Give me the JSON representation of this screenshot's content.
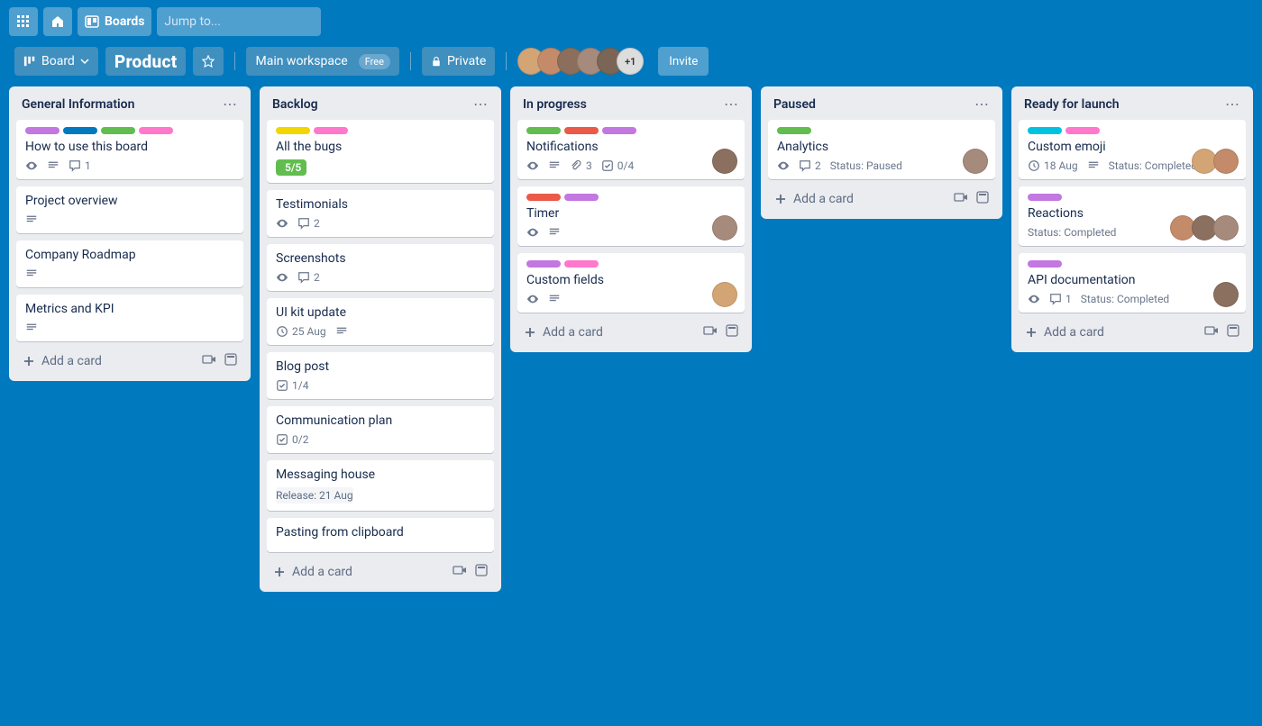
{
  "topbar": {
    "boards": "Boards",
    "search_placeholder": "Jump to..."
  },
  "subbar": {
    "board_btn": "Board",
    "board_name": "Product",
    "workspace": "Main workspace",
    "free": "Free",
    "private": "Private",
    "plus": "+1",
    "invite": "Invite"
  },
  "lists": [
    {
      "title": "General Information",
      "cards": [
        {
          "title": "How to use this board",
          "labels": [
            "purple",
            "blue",
            "green",
            "pink"
          ],
          "badges": {
            "eye": true,
            "desc": true,
            "comments": "1"
          }
        },
        {
          "title": "Project overview",
          "badges": {
            "desc": true
          }
        },
        {
          "title": "Company Roadmap",
          "badges": {
            "desc": true
          }
        },
        {
          "title": "Metrics and KPI",
          "badges": {
            "desc": true
          }
        }
      ]
    },
    {
      "title": "Backlog",
      "cards": [
        {
          "title": "All the bugs",
          "labels": [
            "yellow",
            "pink"
          ],
          "badges": {
            "check_done": "5/5"
          }
        },
        {
          "title": "Testimonials",
          "badges": {
            "eye": true,
            "comments": "2"
          }
        },
        {
          "title": "Screenshots",
          "badges": {
            "eye": true,
            "comments": "2"
          }
        },
        {
          "title": "UI kit update",
          "badges": {
            "date": "25 Aug",
            "desc": true
          }
        },
        {
          "title": "Blog post",
          "badges": {
            "check": "1/4"
          }
        },
        {
          "title": "Communication plan",
          "badges": {
            "check": "0/2"
          }
        },
        {
          "title": "Messaging house",
          "badges": {
            "release": "Release: 21 Aug"
          }
        },
        {
          "title": "Pasting from clipboard"
        }
      ]
    },
    {
      "title": "In progress",
      "cards": [
        {
          "title": "Notifications",
          "labels": [
            "green",
            "red",
            "purple"
          ],
          "badges": {
            "eye": true,
            "desc": true,
            "attach": "3",
            "check": "0/4"
          },
          "avatars": 1
        },
        {
          "title": "Timer",
          "labels": [
            "red",
            "purple"
          ],
          "badges": {
            "eye": true,
            "desc": true
          },
          "avatars": 1
        },
        {
          "title": "Custom fields",
          "labels": [
            "purple",
            "pink"
          ],
          "badges": {
            "eye": true,
            "desc": true
          },
          "avatars": 1
        }
      ]
    },
    {
      "title": "Paused",
      "cards": [
        {
          "title": "Analytics",
          "labels": [
            "green"
          ],
          "badges": {
            "eye": true,
            "comments": "2",
            "status": "Status: Paused"
          },
          "avatars": 1
        }
      ]
    },
    {
      "title": "Ready for launch",
      "cards": [
        {
          "title": "Custom emoji",
          "labels": [
            "cyan",
            "pink"
          ],
          "badges": {
            "date": "18 Aug",
            "desc": true,
            "status": "Status: Completed"
          },
          "avatars": 2
        },
        {
          "title": "Reactions",
          "labels": [
            "purple"
          ],
          "badges": {
            "status": "Status: Completed"
          },
          "avatars": 3
        },
        {
          "title": "API documentation",
          "labels": [
            "purple"
          ],
          "badges": {
            "eye": true,
            "comments": "1",
            "status": "Status: Completed"
          },
          "avatars": 1
        }
      ]
    }
  ],
  "add_card": "Add a card"
}
